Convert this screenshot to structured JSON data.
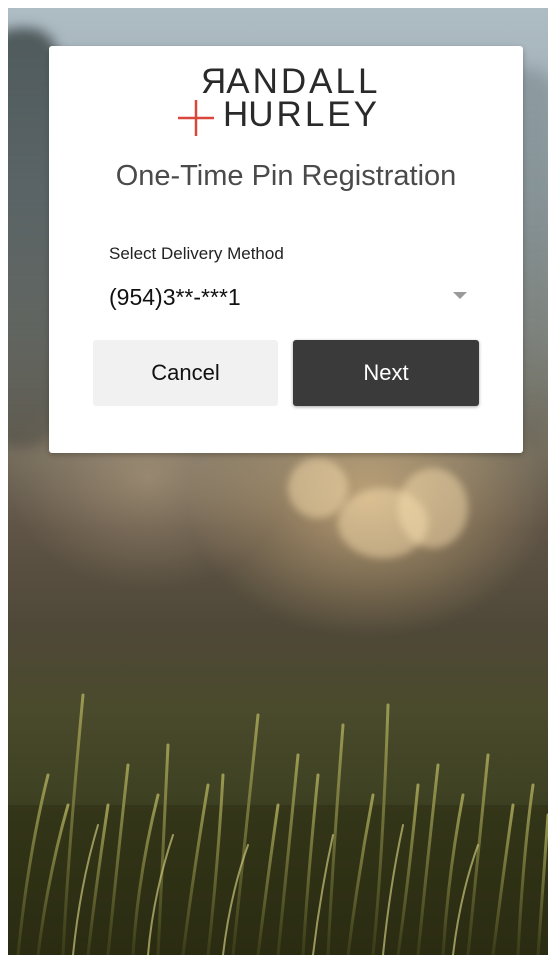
{
  "logo": {
    "line1": "RANDALL",
    "line2": "HURLEY",
    "first_letter_line1": "R",
    "rest_line1": "ANDALL",
    "first_letter_line2": "H",
    "rest_line2": "URLEY",
    "cross_color": "#d9473a"
  },
  "dialog": {
    "title": "One-Time Pin Registration",
    "field_label": "Select Delivery Method",
    "selected_value": "(954)3**-***1",
    "cancel_label": "Cancel",
    "next_label": "Next"
  },
  "colors": {
    "next_button_bg": "#3a3a3a",
    "cancel_button_bg": "#f1f1f1"
  },
  "icons": {
    "dropdown": "chevron-down-icon"
  }
}
